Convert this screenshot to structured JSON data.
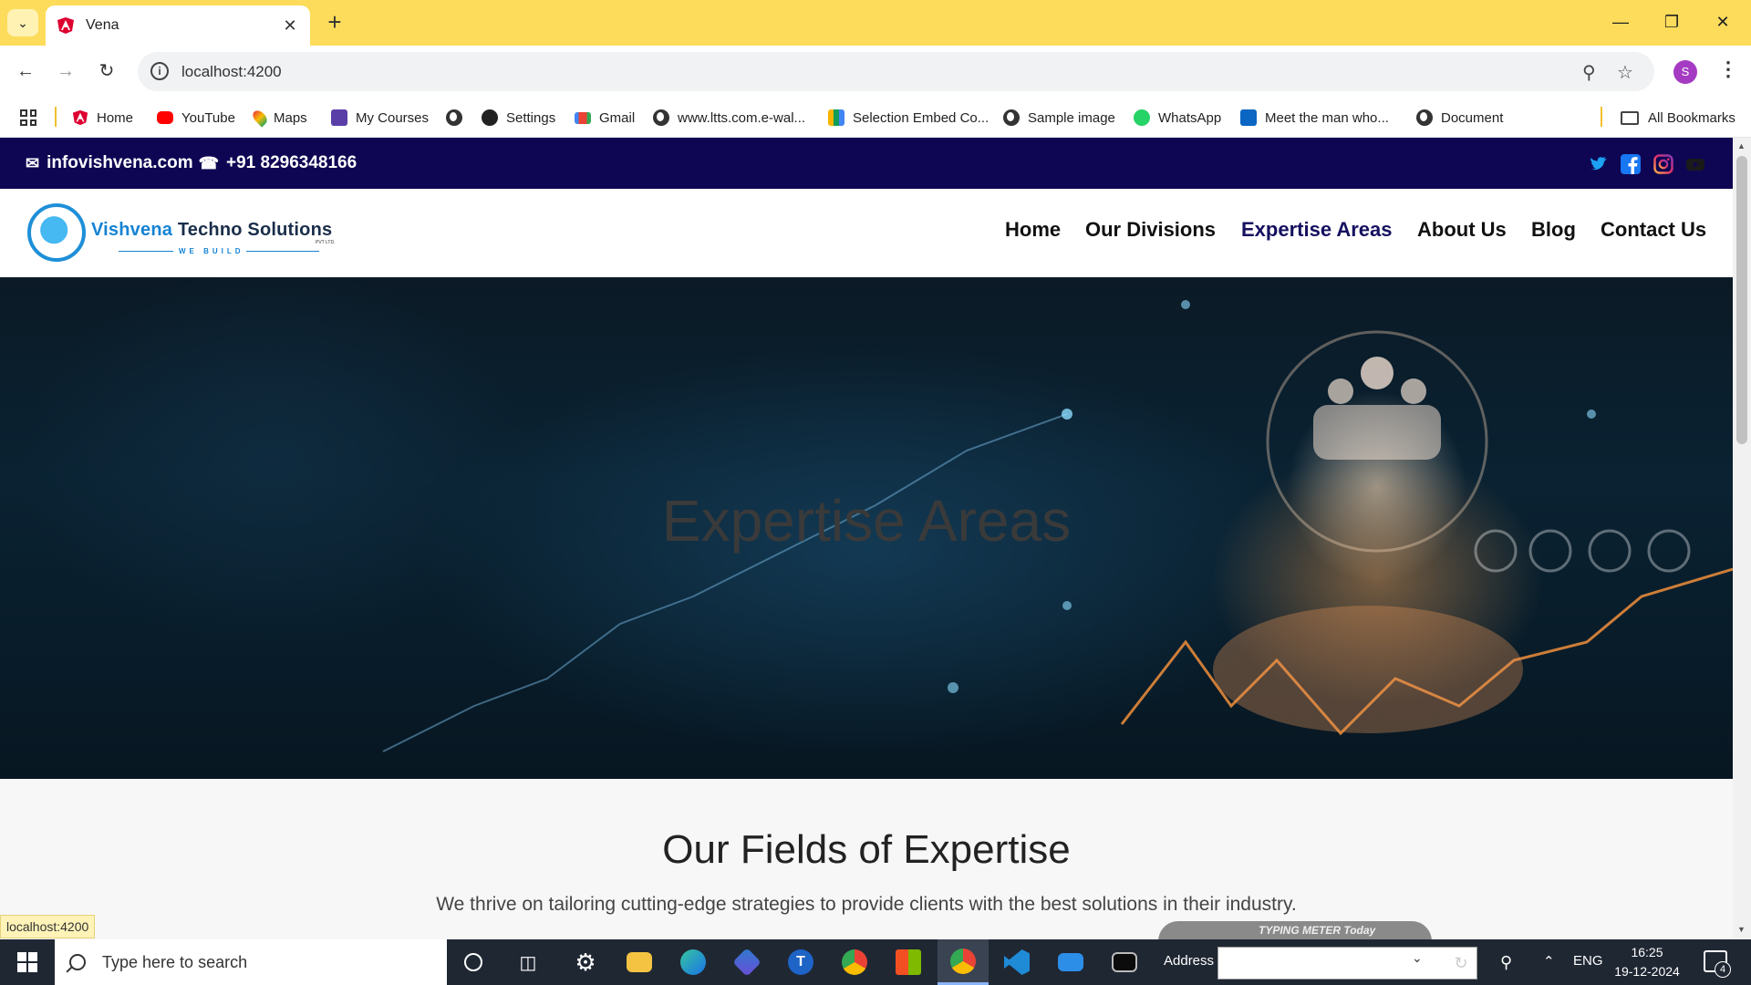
{
  "browser": {
    "tab_title": "Vena",
    "url": "localhost:4200",
    "profile_initial": "S",
    "bookmarks": [
      {
        "label": "Home",
        "icon": "angular-icon"
      },
      {
        "label": "YouTube",
        "icon": "youtube-icon"
      },
      {
        "label": "Maps",
        "icon": "maps-icon"
      },
      {
        "label": "My Courses",
        "icon": "courses-icon"
      },
      {
        "label": "",
        "icon": "globe-icon"
      },
      {
        "label": "Settings",
        "icon": "github-icon"
      },
      {
        "label": "Gmail",
        "icon": "gmail-icon"
      },
      {
        "label": "www.ltts.com.e-wal...",
        "icon": "globe-icon"
      },
      {
        "label": "Selection Embed Co...",
        "icon": "embed-icon"
      },
      {
        "label": "Sample image",
        "icon": "globe-icon"
      },
      {
        "label": "WhatsApp",
        "icon": "whatsapp-icon"
      },
      {
        "label": "Meet the man who...",
        "icon": "linkedin-icon"
      },
      {
        "label": "Document",
        "icon": "globe-icon"
      }
    ],
    "all_bookmarks": "All Bookmarks",
    "status_url": "localhost:4200"
  },
  "site": {
    "email": "infovishvena.com",
    "phone": "+91 8296348166",
    "logo": {
      "name_part1": "Vishvena",
      "name_part2": "Techno Solutions",
      "pvt": "PVT LTD.",
      "tagline": "WE BUILD"
    },
    "nav": [
      "Home",
      "Our Divisions",
      "Expertise Areas",
      "About Us",
      "Blog",
      "Contact Us"
    ],
    "active_nav": "Expertise Areas",
    "hero_title": "Expertise Areas",
    "section_title": "Our Fields of Expertise",
    "section_subtitle": "We thrive on tailoring cutting-edge strategies to provide clients with the best solutions in their industry.",
    "colors": {
      "topbar": "#0e0653",
      "accent": "#1583d4",
      "active_nav": "#15105f"
    }
  },
  "overlay": {
    "typing_meter": "TYPING METER Today"
  },
  "taskbar": {
    "search_placeholder": "Type here to search",
    "address_label": "Address",
    "language": "ENG",
    "time": "16:25",
    "date": "19-12-2024",
    "notification_count": "4"
  }
}
